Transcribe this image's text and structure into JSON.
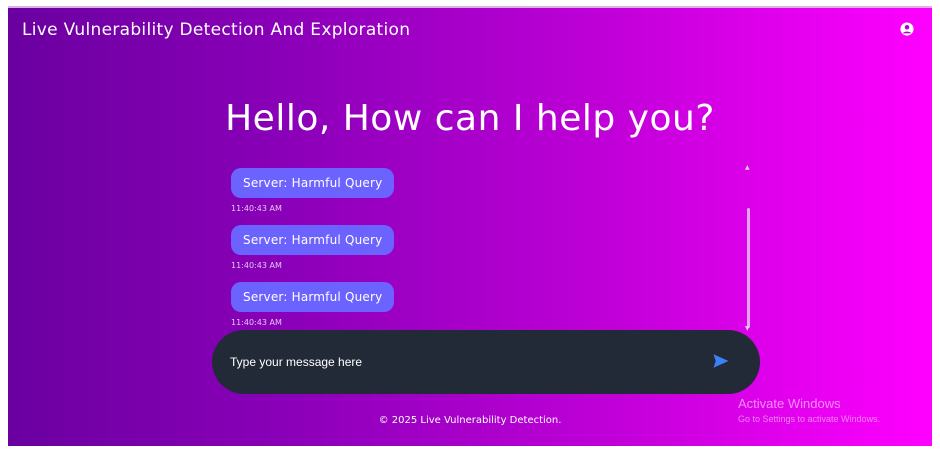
{
  "header": {
    "title": "Live Vulnerability Detection And Exploration",
    "user_icon": "user-circle-icon"
  },
  "hero": {
    "heading": "Hello, How can I help you?"
  },
  "chat": {
    "messages": [
      {
        "text": "Server: Harmful Query",
        "time": "11:40:43 AM"
      },
      {
        "text": "Server: Harmful Query",
        "time": "11:40:43 AM"
      },
      {
        "text": "Server: Harmful Query",
        "time": "11:40:43 AM"
      }
    ]
  },
  "composer": {
    "placeholder": "Type your message here",
    "value": "",
    "send_icon": "send-icon"
  },
  "footer": {
    "text": "© 2025 Live Vulnerability Detection."
  },
  "watermark": {
    "title": "Activate Windows",
    "subtitle": "Go to Settings to activate Windows."
  },
  "colors": {
    "gradient_start": "#6a00a0",
    "gradient_end": "#ff00ff",
    "bubble": "#6c63ff",
    "composer_bg": "#222a38",
    "send_icon": "#3b82f6"
  }
}
